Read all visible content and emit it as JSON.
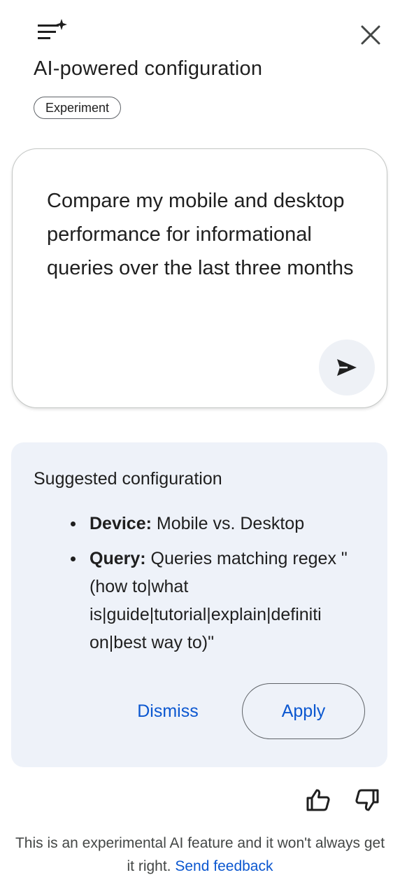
{
  "header": {
    "icon": "tune-sparkle-icon",
    "close_icon": "close-icon",
    "title": "AI-powered configuration",
    "badge": "Experiment"
  },
  "prompt": {
    "text": "Compare my mobile and desktop performance for informational queries over the last three months",
    "send_icon": "send-icon"
  },
  "suggestion": {
    "title": "Suggested configuration",
    "items": [
      {
        "key": "Device:",
        "value": " Mobile vs. Desktop"
      },
      {
        "key": "Query:",
        "value": " Queries matching regex \"(how to|what is|guide|tutorial|explain|definiti on|best way to)\""
      }
    ],
    "dismiss_label": "Dismiss",
    "apply_label": "Apply"
  },
  "feedback": {
    "thumb_up_icon": "thumb-up-icon",
    "thumb_down_icon": "thumb-down-icon",
    "disclaimer": "This is an experimental AI feature and it won't always get it right.",
    "link_label": "Send feedback"
  },
  "colors": {
    "accent": "#0b57d0",
    "suggestion_bg": "#eef2f9",
    "send_bg": "#eef1f6",
    "text": "#1f1f1f"
  }
}
